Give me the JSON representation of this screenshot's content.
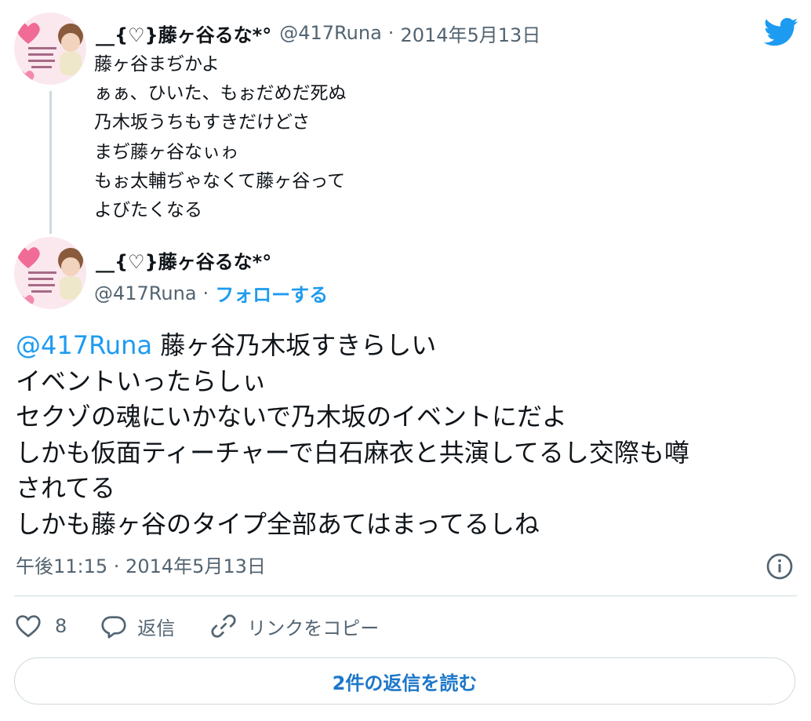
{
  "parent_tweet": {
    "display_name": "__{♡}藤ヶ谷るな*°",
    "handle": "@417Runa",
    "separator": "·",
    "date": "2014年5月13日",
    "lines": [
      "藤ヶ谷まぢかよ",
      "ぁぁ、ひいた、もぉだめだ死ぬ",
      "乃木坂うちもすきだけどさ",
      "まぢ藤ヶ谷なぃゎ",
      "もぉ太輔ぢゃなくて藤ヶ谷って",
      "よびたくなる"
    ]
  },
  "main_tweet": {
    "display_name": "__{♡}藤ヶ谷るな*°",
    "handle": "@417Runa",
    "separator": "·",
    "follow_label": "フォローする",
    "mention": "@417Runa",
    "first_line_rest": " 藤ヶ谷乃木坂すきらしい",
    "lines": [
      "イベントいったらしぃ",
      "セクゾの魂にいかないで乃木坂のイベントにだよ",
      "しかも仮面ティーチャーで白石麻衣と共演してるし交際も噂",
      "されてる",
      "しかも藤ヶ谷のタイプ全部あてはまってるしね"
    ],
    "timestamp": "午後11:15 · 2014年5月13日",
    "like_count": "8",
    "reply_label": "返信",
    "copy_link_label": "リンクをコピー",
    "read_replies_label": "2件の返信を読む"
  },
  "icons": {
    "brand": "twitter-bird-icon",
    "info": "info-icon",
    "like": "heart-icon",
    "reply": "speech-bubble-icon",
    "copy": "link-icon"
  },
  "colors": {
    "accent": "#1d9bf0",
    "text": "#0f1419",
    "muted": "#536471",
    "border": "#cfd9de"
  }
}
